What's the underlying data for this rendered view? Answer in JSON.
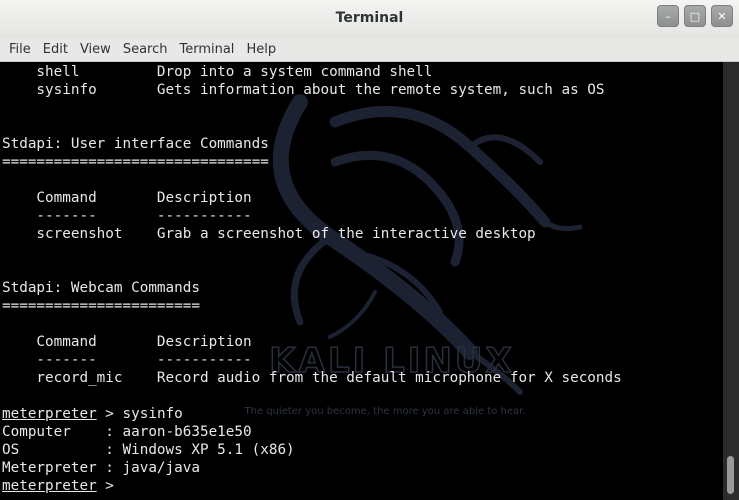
{
  "window": {
    "title": "Terminal",
    "controls": [
      "–",
      "□",
      "✕"
    ]
  },
  "menubar": {
    "items": [
      "File",
      "Edit",
      "View",
      "Search",
      "Terminal",
      "Help"
    ]
  },
  "terminal": {
    "lines": [
      "    shell         Drop into a system command shell",
      "    sysinfo       Gets information about the remote system, such as OS",
      "",
      "",
      "Stdapi: User interface Commands",
      "===============================",
      "",
      "    Command       Description",
      "    -------       -----------",
      "    screenshot    Grab a screenshot of the interactive desktop",
      "",
      "",
      "Stdapi: Webcam Commands",
      "=======================",
      "",
      "    Command       Description",
      "    -------       -----------",
      "    record_mic    Record audio from the default microphone for X seconds",
      "",
      "meterpreter > sysinfo",
      "Computer    : aaron-b635e1e50",
      "OS          : Windows XP 5.1 (x86)",
      "Meterpreter : java/java",
      "meterpreter > "
    ],
    "prompt_word": "meterpreter",
    "background_logo_text": "KALI LINUX",
    "background_tagline": "The quieter you become, the more you are able to hear."
  },
  "colors": {
    "terminal_bg": "#000000",
    "terminal_fg": "#e8e8e8",
    "titlebar_bg": "#eeeeec",
    "logo_color": "#1c2232"
  }
}
